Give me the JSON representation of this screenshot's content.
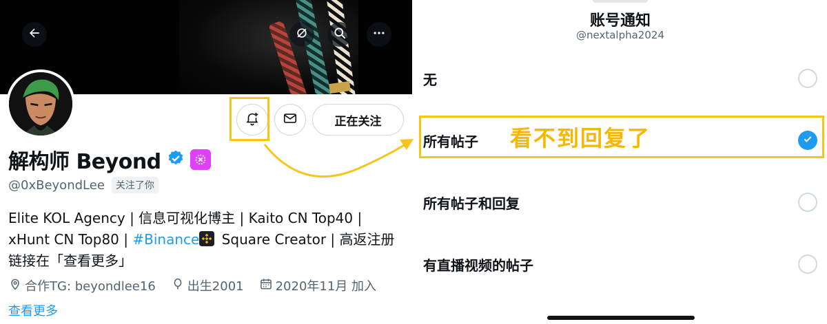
{
  "profile": {
    "name": "解构师 Beyond",
    "handle": "@0xBeyondLee",
    "follows_you": "关注了你",
    "follow_button": "正在关注",
    "bio": {
      "line1": "Elite KOL Agency | 信息可视化博主 | Kaito CN Top40 |",
      "line2_pre": "xHunt CN Top80 | ",
      "line2_tag": "#Binance",
      "line2_post": " Square Creator | 高返注册",
      "line3": "链接在「查看更多」"
    },
    "meta": {
      "location": "合作TG: beyondlee16",
      "birth": "出生2001",
      "joined": "2020年11月 加入"
    },
    "see_more": "查看更多",
    "icons": {
      "back": "arrow-left-icon",
      "grok": "grok-icon",
      "search": "search-icon",
      "more": "more-icon",
      "notify": "bell-plus-icon",
      "message": "envelope-icon",
      "verified": "verified-badge-icon",
      "affiliate": "affiliate-badge-icon",
      "binance": "binance-logo-icon",
      "location": "location-pin-icon",
      "birth": "balloon-icon",
      "calendar": "calendar-icon"
    }
  },
  "sheet": {
    "title": "账号通知",
    "subtitle": "@nextalpha2024",
    "options": [
      {
        "label": "无",
        "selected": false
      },
      {
        "label": "所有帖子",
        "selected": true
      },
      {
        "label": "所有帖子和回复",
        "selected": false
      },
      {
        "label": "有直播视频的帖子",
        "selected": false
      }
    ],
    "annotation": "看不到回复了"
  },
  "colors": {
    "accent": "#1d9bf0",
    "highlight": "#f5c518",
    "annotation": "#f5b800",
    "text_primary": "#0f1419",
    "text_secondary": "#536471",
    "affiliate_badge": "#e040fb"
  }
}
